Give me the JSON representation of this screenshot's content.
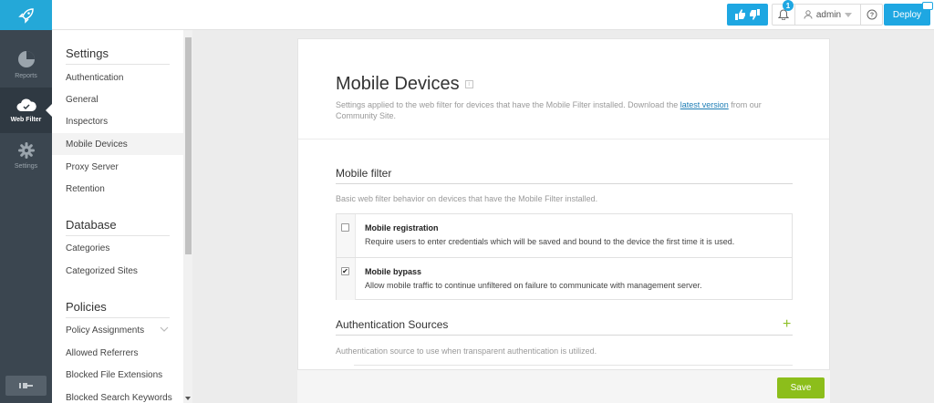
{
  "colors": {
    "accent": "#1ea7e2",
    "rail_bg": "#3b4650",
    "save_green": "#8cbe1b",
    "link": "#1d7db5"
  },
  "rail": {
    "logo_icon": "rocket-icon",
    "items": [
      {
        "label": "Reports",
        "icon": "pie-chart-icon"
      },
      {
        "label": "Web Filter",
        "icon": "cloud-icon"
      },
      {
        "label": "Settings",
        "icon": "gear-icon"
      }
    ],
    "collapse_icon": "collapse-icon"
  },
  "topbar": {
    "feedback_icons": [
      "thumbs-up-icon",
      "thumbs-down-icon"
    ],
    "notifications_count": "1",
    "user": "admin",
    "deploy_label": "Deploy"
  },
  "sidebar": {
    "sections": [
      {
        "heading": "Settings",
        "items": [
          "Authentication",
          "General",
          "Inspectors",
          "Mobile Devices",
          "Proxy Server",
          "Retention"
        ]
      },
      {
        "heading": "Database",
        "items": [
          "Categories",
          "Categorized Sites"
        ]
      },
      {
        "heading": "Policies",
        "items": [
          "Policy Assignments",
          "Allowed Referrers",
          "Blocked File Extensions",
          "Blocked Search Keywords"
        ]
      }
    ],
    "active_item": "Mobile Devices"
  },
  "page": {
    "title": "Mobile Devices",
    "desc_before": "Settings applied to the web filter for devices that have the Mobile Filter installed. Download the ",
    "desc_link": "latest version",
    "desc_after": " from our Community Site."
  },
  "mobile_filter": {
    "title": "Mobile filter",
    "desc": "Basic web filter behavior on devices that have the Mobile Filter installed.",
    "options": [
      {
        "title": "Mobile registration",
        "desc": "Require users to enter credentials which will be saved and bound to the device the first time it is used.",
        "checked": false
      },
      {
        "title": "Mobile bypass",
        "desc": "Allow mobile traffic to continue unfiltered on failure to communicate with management server.",
        "checked": true
      }
    ]
  },
  "auth_sources": {
    "title": "Authentication Sources",
    "desc": "Authentication source to use when transparent authentication is utilized.",
    "add_symbol": "+"
  },
  "footer": {
    "save_label": "Save"
  }
}
